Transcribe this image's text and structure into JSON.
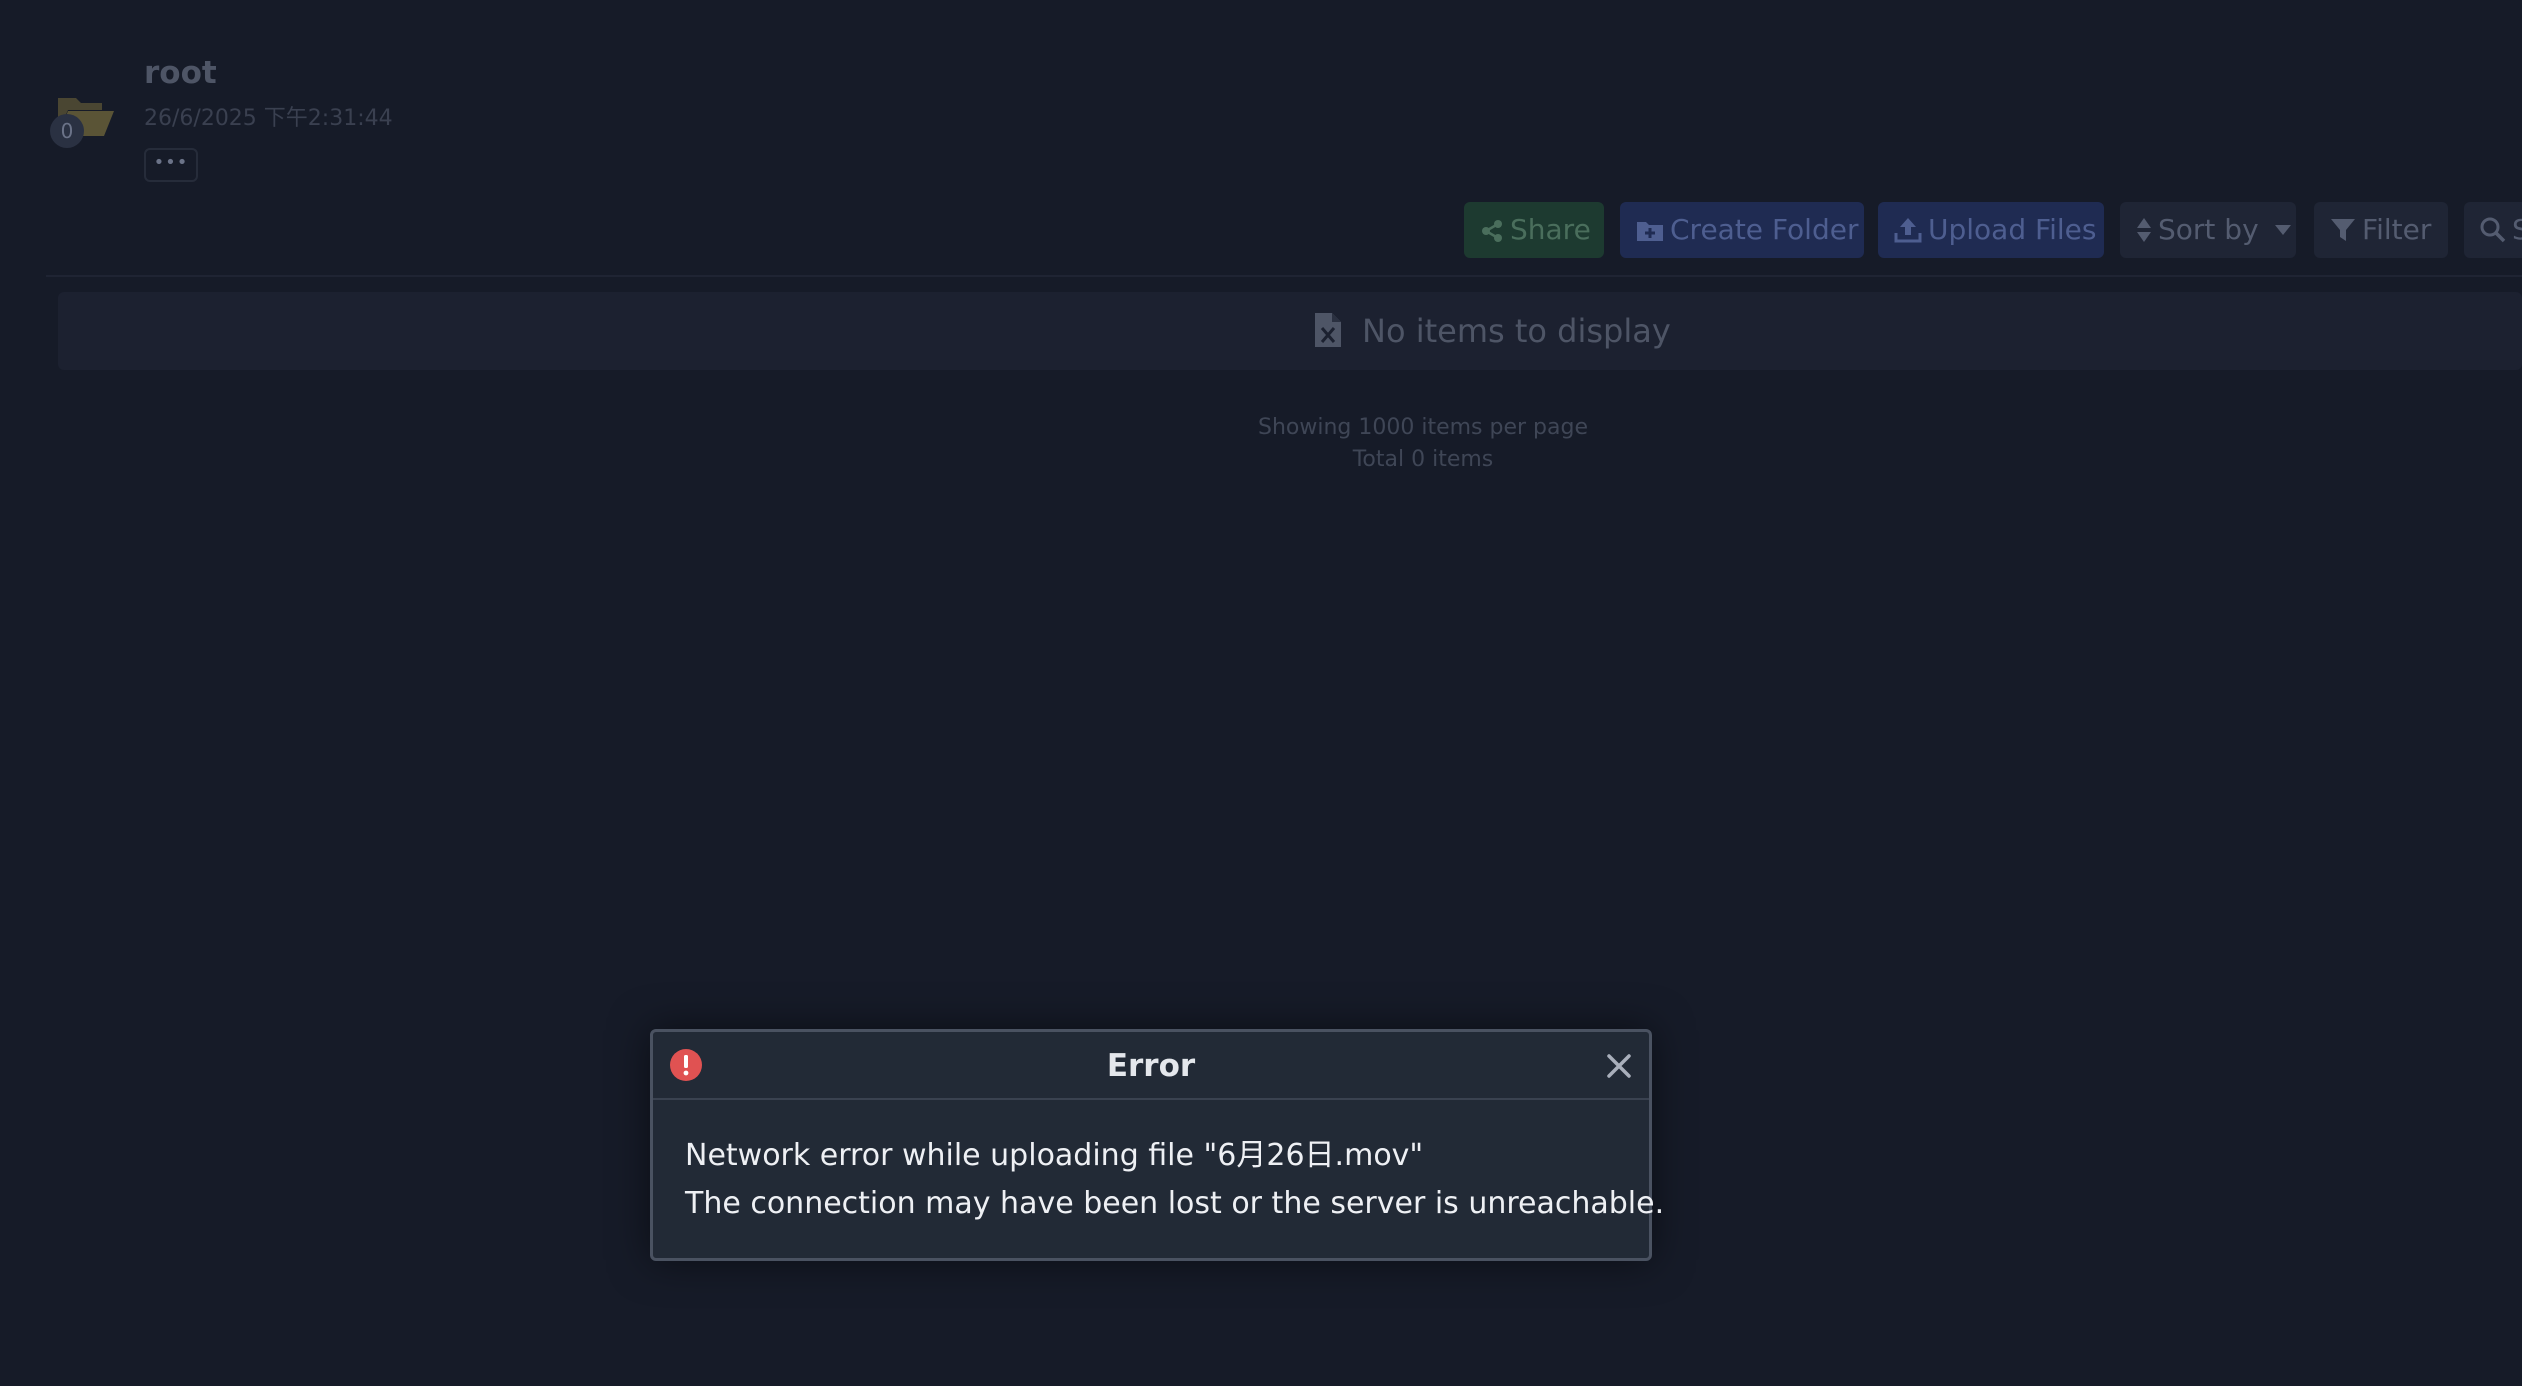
{
  "folder": {
    "name": "root",
    "date": "26/6/2025 下午2:31:44",
    "count": "0",
    "more_label": "•••"
  },
  "toolbar": {
    "share": "Share",
    "create_folder": "Create Folder",
    "upload_files": "Upload Files",
    "sort_by": "Sort by",
    "filter": "Filter",
    "search": "S"
  },
  "list": {
    "empty_text": "No items to display",
    "per_page": "Showing 1000 items per page",
    "total": "Total 0 items"
  },
  "dialog": {
    "title": "Error",
    "line1": "Network error while uploading file \"6月26日.mov\"",
    "line2": "The connection may have been lost or the server is unreachable."
  },
  "colors": {
    "background": "#161b28",
    "error_red": "#e05252",
    "share_green": "#1d3a30",
    "primary_blue": "#1f2b52"
  }
}
